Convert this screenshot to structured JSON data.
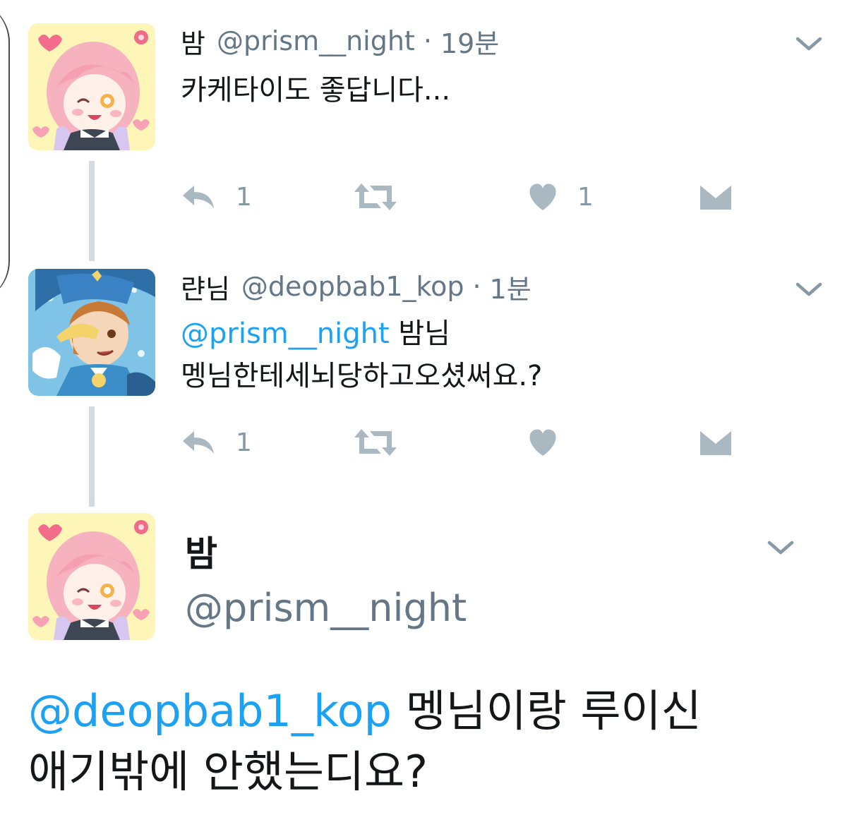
{
  "tweets": [
    {
      "name": "밤",
      "handle": "@prism__night",
      "separator": "·",
      "time": "19분",
      "text": "카케타이도 좋답니다...",
      "reply_count": "1",
      "like_count": "1"
    },
    {
      "name": "랸님",
      "handle": "@deopbab1_kop",
      "separator": "·",
      "time": "1분",
      "mention": "@prism__night",
      "text_line1": " 밤님",
      "text_line2": "멩님한테세뇌당하고오셨써요.?",
      "reply_count": "1"
    }
  ],
  "focus": {
    "name": "밤",
    "handle": "@prism__night",
    "mention": "@deopbab1_kop",
    "text_line1": " 멩님이랑 루이신",
    "text_line2": "애기밖에 안했는디요?"
  },
  "icons": {
    "chevron": "chevron-down-icon",
    "reply": "reply-icon",
    "retweet": "retweet-icon",
    "like": "heart-icon",
    "dm": "envelope-icon"
  },
  "colors": {
    "mention": "#1da1f2",
    "muted": "#657786",
    "icon": "#aab8c2",
    "thread_line": "#d3dbe2"
  }
}
